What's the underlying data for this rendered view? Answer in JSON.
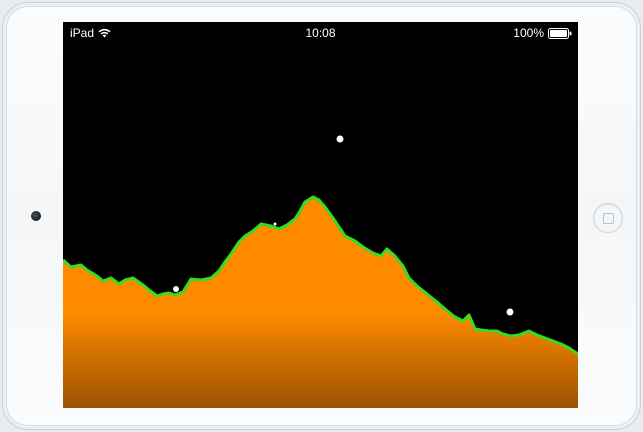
{
  "status_bar": {
    "carrier": "iPad",
    "time": "10:08",
    "battery": "100%"
  },
  "icons": {
    "wifi": "wifi-icon",
    "battery": "battery-full-icon",
    "camera": "front-camera",
    "home": "home-button"
  },
  "colors": {
    "sky": "#000000",
    "terrain_top": "#ff8a00",
    "terrain_bottom": "#9a5200",
    "ridge_outline": "#33dd22",
    "star": "#ffffff"
  }
}
